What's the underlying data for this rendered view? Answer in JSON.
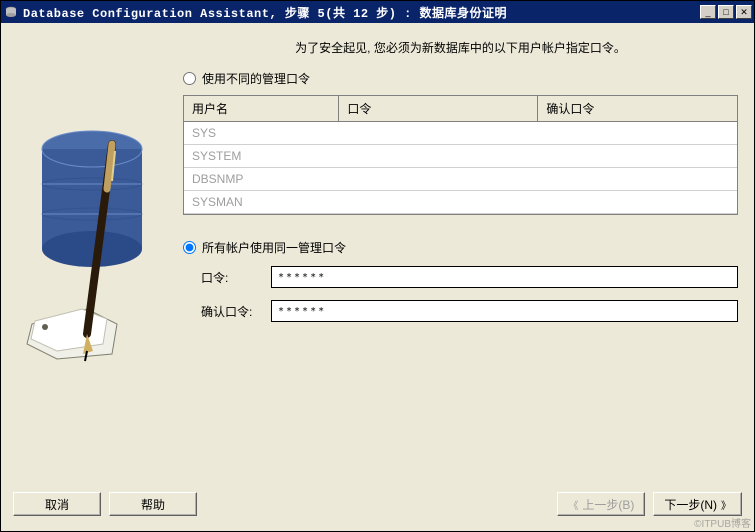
{
  "window": {
    "title": "Database Configuration Assistant, 步骤 5(共 12 步) : 数据库身份证明"
  },
  "instruction": "为了安全起见, 您必须为新数据库中的以下用户帐户指定口令。",
  "options": {
    "different_label": "使用不同的管理口令",
    "same_label": "所有帐户使用同一管理口令"
  },
  "table": {
    "headers": {
      "user": "用户名",
      "password": "口令",
      "confirm": "确认口令"
    },
    "rows": [
      {
        "user": "SYS",
        "password": "",
        "confirm": ""
      },
      {
        "user": "SYSTEM",
        "password": "",
        "confirm": ""
      },
      {
        "user": "DBSNMP",
        "password": "",
        "confirm": ""
      },
      {
        "user": "SYSMAN",
        "password": "",
        "confirm": ""
      }
    ]
  },
  "fields": {
    "password_label": "口令:",
    "password_value": "******",
    "confirm_label": "确认口令:",
    "confirm_value": "******"
  },
  "buttons": {
    "cancel": "取消",
    "help": "帮助",
    "back": "上一步(B)",
    "next": "下一步(N)"
  },
  "watermark": "©ITPUB博客"
}
